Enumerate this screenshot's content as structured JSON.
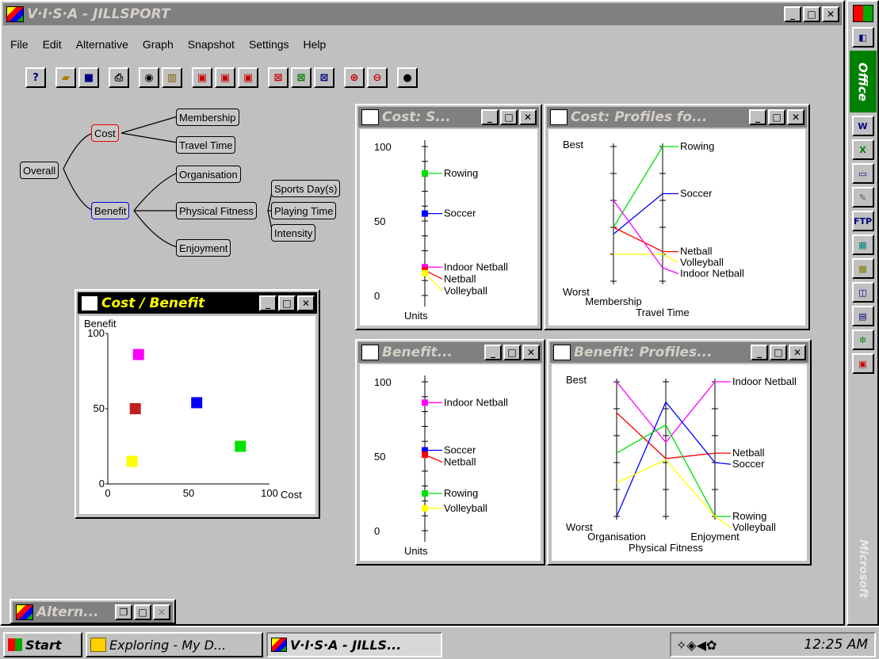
{
  "window": {
    "title": "V·I·S·A - JILLSPORT"
  },
  "menu": [
    "File",
    "Edit",
    "Alternative",
    "Graph",
    "Snapshot",
    "Settings",
    "Help"
  ],
  "tree": {
    "overall": "Overall",
    "cost": "Cost",
    "benefit": "Benefit",
    "membership": "Membership",
    "travel_time": "Travel Time",
    "organisation": "Organisation",
    "physical_fitness": "Physical Fitness",
    "enjoyment": "Enjoyment",
    "sports_days": "Sports Day(s)",
    "playing_time": "Playing Time",
    "intensity": "Intensity"
  },
  "windows": {
    "cost_scores": {
      "title": "Cost: S..."
    },
    "cost_profiles": {
      "title": "Cost: Profiles fo..."
    },
    "benefit_scores": {
      "title": "Benefit..."
    },
    "benefit_profiles": {
      "title": "Benefit: Profiles..."
    },
    "cost_benefit": {
      "title": "Cost / Benefit"
    },
    "alternatives": {
      "title": "Altern..."
    }
  },
  "colors": {
    "Rowing": "#00e000",
    "Soccer": "#0000ff",
    "Indoor Netball": "#ff00ff",
    "Netball": "#ff0000",
    "Volleyball": "#ffff00",
    "Netball_cb": "#c02020"
  },
  "chart_data": [
    {
      "type": "scatter",
      "title": "Cost: S...",
      "ylabel": "Units",
      "ylim": [
        0,
        100
      ],
      "ticks": [
        "100",
        "50",
        "0"
      ],
      "series": [
        {
          "name": "Rowing",
          "values": [
            82
          ]
        },
        {
          "name": "Soccer",
          "values": [
            55
          ]
        },
        {
          "name": "Indoor Netball",
          "values": [
            19
          ]
        },
        {
          "name": "Netball",
          "values": [
            17
          ]
        },
        {
          "name": "Volleyball",
          "values": [
            15
          ]
        }
      ]
    },
    {
      "type": "line",
      "title": "Cost: Profiles fo...",
      "categories": [
        "Membership",
        "Travel Time"
      ],
      "top_label": "Best",
      "bottom_label": "Worst",
      "ylim": [
        0,
        100
      ],
      "series": [
        {
          "name": "Rowing",
          "values": [
            40,
            100
          ]
        },
        {
          "name": "Soccer",
          "values": [
            35,
            65
          ]
        },
        {
          "name": "Netball",
          "values": [
            40,
            22
          ]
        },
        {
          "name": "Volleyball",
          "values": [
            20,
            20
          ]
        },
        {
          "name": "Indoor Netball",
          "values": [
            60,
            10
          ]
        }
      ],
      "labels": [
        "Rowing",
        "Soccer",
        "Netball",
        "Volleyball",
        "Indoor Netball"
      ]
    },
    {
      "type": "scatter",
      "title": "Benefit...",
      "ylabel": "Units",
      "ylim": [
        0,
        100
      ],
      "ticks": [
        "100",
        "50",
        "0"
      ],
      "series": [
        {
          "name": "Indoor Netball",
          "values": [
            86
          ]
        },
        {
          "name": "Soccer",
          "values": [
            54
          ]
        },
        {
          "name": "Netball",
          "values": [
            51
          ]
        },
        {
          "name": "Rowing",
          "values": [
            25
          ]
        },
        {
          "name": "Volleyball",
          "values": [
            15
          ]
        }
      ]
    },
    {
      "type": "line",
      "title": "Benefit: Profiles...",
      "categories": [
        "Organisation",
        "Physical Fitness",
        "Enjoyment"
      ],
      "top_label": "Best",
      "bottom_label": "Worst",
      "ylim": [
        0,
        100
      ],
      "series": [
        {
          "name": "Indoor Netball",
          "values": [
            100,
            55,
            100
          ]
        },
        {
          "name": "Netball",
          "values": [
            77,
            43,
            47
          ]
        },
        {
          "name": "Soccer",
          "values": [
            0,
            85,
            40
          ]
        },
        {
          "name": "Rowing",
          "values": [
            47,
            68,
            0
          ]
        },
        {
          "name": "Volleyball",
          "values": [
            25,
            42,
            0
          ]
        }
      ],
      "labels": [
        "Indoor Netball",
        "Netball",
        "Soccer",
        "Rowing",
        "Volleyball"
      ]
    },
    {
      "type": "scatter",
      "title": "Cost / Benefit",
      "xlabel": "Cost",
      "ylabel": "Benefit",
      "xlim": [
        0,
        100
      ],
      "ylim": [
        0,
        100
      ],
      "xticks": [
        "0",
        "50",
        "100"
      ],
      "yticks": [
        "100",
        "50",
        "0"
      ],
      "series": [
        {
          "name": "Indoor Netball",
          "x": 19,
          "y": 86
        },
        {
          "name": "Netball",
          "x": 17,
          "y": 50
        },
        {
          "name": "Soccer",
          "x": 55,
          "y": 54
        },
        {
          "name": "Rowing",
          "x": 82,
          "y": 25
        },
        {
          "name": "Volleyball",
          "x": 15,
          "y": 15
        }
      ]
    }
  ],
  "taskbar": {
    "start": "Start",
    "task1": "Exploring - My D...",
    "task2": "V·I·S·A - JILLS...",
    "clock": "12:25 AM"
  },
  "office": {
    "label": "Office",
    "brand": "Microsoft"
  }
}
